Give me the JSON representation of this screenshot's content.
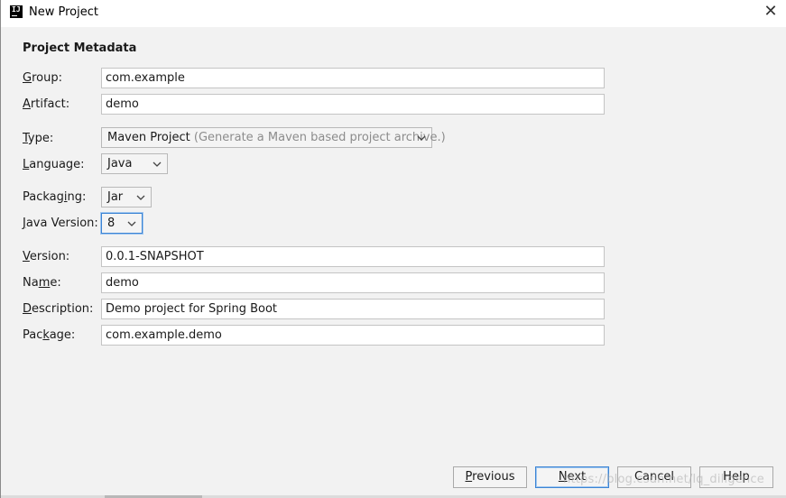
{
  "window": {
    "title": "New Project",
    "close_glyph": "✕",
    "app_icon_text": "IJ"
  },
  "section_title": "Project Metadata",
  "fields": {
    "group": {
      "label_accel": "G",
      "label_rest": "roup:",
      "value": "com.example"
    },
    "artifact": {
      "label_accel": "A",
      "label_rest": "rtifact:",
      "value": "demo"
    },
    "version": {
      "label_accel": "V",
      "label_rest": "ersion:",
      "value": "0.0.1-SNAPSHOT"
    },
    "name": {
      "label_pre": "Na",
      "label_accel": "m",
      "label_rest": "e:",
      "value": "demo"
    },
    "description": {
      "label_accel": "D",
      "label_rest": "escription:",
      "value": "Demo project for Spring Boot"
    },
    "package": {
      "label_pre": "Pac",
      "label_accel": "k",
      "label_rest": "age:",
      "value": "com.example.demo"
    }
  },
  "combos": {
    "type": {
      "label_accel": "T",
      "label_rest": "ype:",
      "value": "Maven Project",
      "hint": "(Generate a Maven based project archive.)"
    },
    "language": {
      "label_accel": "L",
      "label_rest": "anguage:",
      "value": "Java"
    },
    "packaging": {
      "label_pre": "Packag",
      "label_accel": "i",
      "label_rest": "ng:",
      "value": "Jar"
    },
    "java_version": {
      "label_accel": "J",
      "label_rest": "ava Version:",
      "value": "8"
    }
  },
  "buttons": {
    "previous": {
      "accel": "P",
      "rest": "revious"
    },
    "next": {
      "accel": "N",
      "rest": "ext"
    },
    "cancel": {
      "text": "Cancel"
    },
    "help": {
      "text": "Help"
    }
  },
  "watermark": "https://blog.csdn.net/lq_diligence",
  "icons": [
    "app-icon",
    "close-icon",
    "chevron-down-icon"
  ],
  "colors": {
    "focus": "#3c84d4",
    "background": "#f2f2f2",
    "hint": "#8c8c8c"
  }
}
